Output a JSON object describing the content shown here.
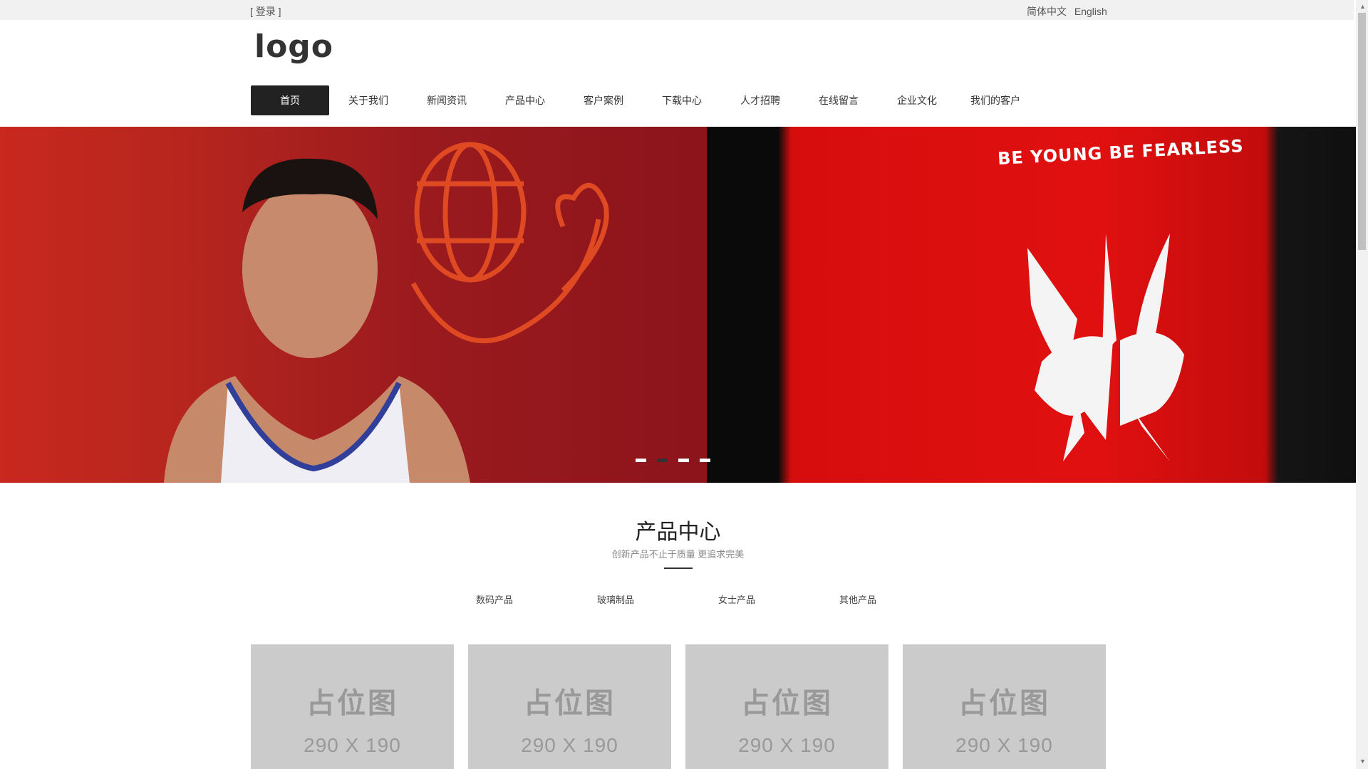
{
  "topbar": {
    "login_label": "[ 登录 ]",
    "lang_zh": "简体中文",
    "lang_en": "English"
  },
  "logo": {
    "text": "logo"
  },
  "nav": {
    "items": [
      {
        "label": "首页",
        "active": true
      },
      {
        "label": "关于我们"
      },
      {
        "label": "新闻资讯"
      },
      {
        "label": "产品中心"
      },
      {
        "label": "客户案例"
      },
      {
        "label": "下载中心"
      },
      {
        "label": "人才招聘"
      },
      {
        "label": "在线留言"
      },
      {
        "label": "企业文化"
      },
      {
        "label": "我们的客户"
      }
    ]
  },
  "banner": {
    "slogan": "BE YOUNG BE FEARLESS",
    "slide_count": 4,
    "active_slide": 2
  },
  "products": {
    "title": "产品中心",
    "subtitle": "创新产品不止于质量 更追求完美",
    "categories": [
      "数码产品",
      "玻璃制品",
      "女士产品",
      "其他产品"
    ],
    "cards": [
      {
        "placeholder": "占位图",
        "size": "290 X 190"
      },
      {
        "placeholder": "占位图",
        "size": "290 X 190"
      },
      {
        "placeholder": "占位图",
        "size": "290 X 190"
      },
      {
        "placeholder": "占位图",
        "size": "290 X 190"
      }
    ]
  },
  "colors": {
    "nav_active": "#222222",
    "banner_red": "#c8281e",
    "placeholder_bg": "#cbcbcb"
  }
}
